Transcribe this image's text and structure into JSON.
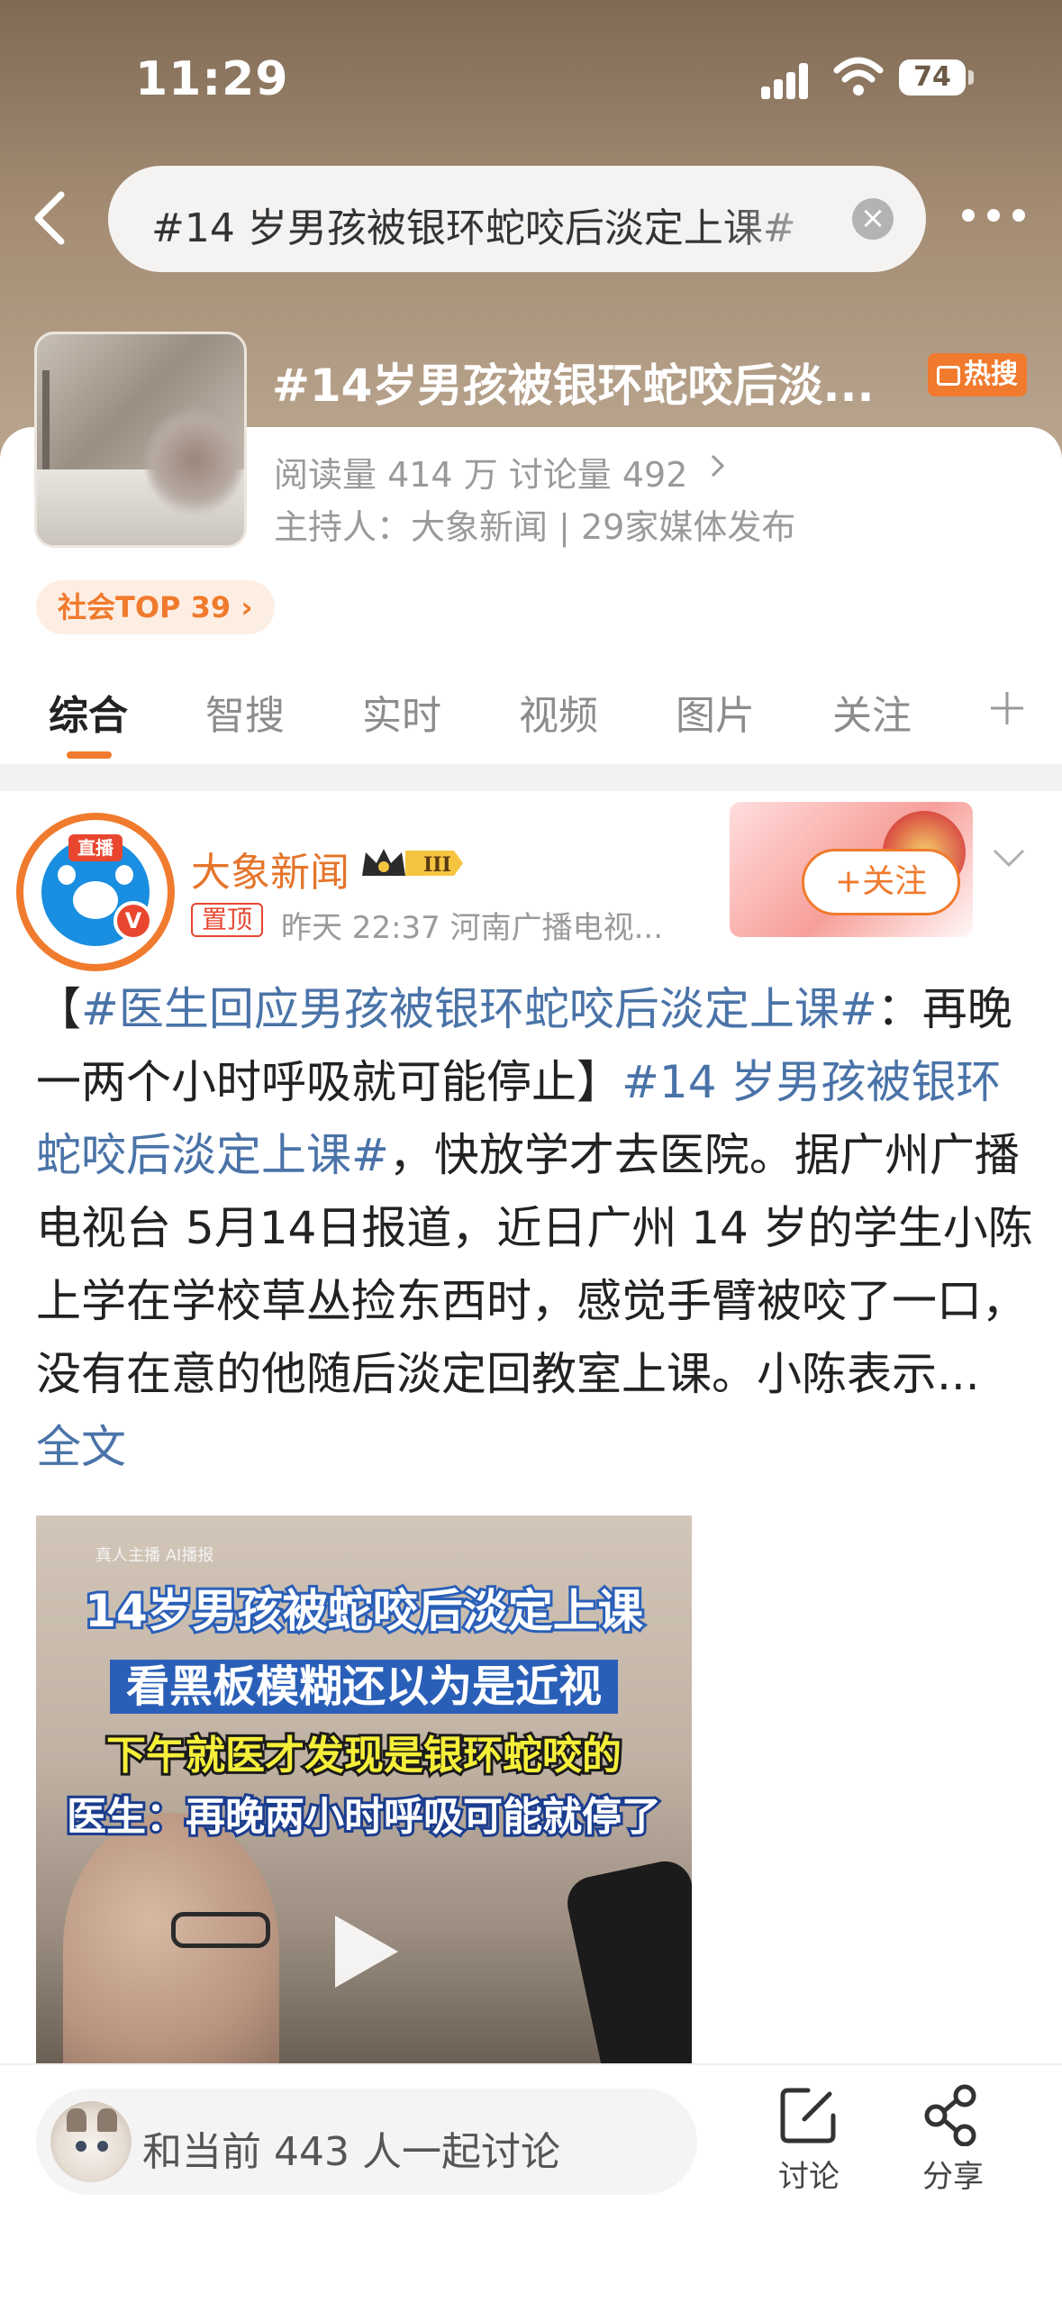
{
  "status_bar": {
    "time": "11:29",
    "battery": "74"
  },
  "search": {
    "query": "#14 岁男孩被银环蛇咬后淡定上课#"
  },
  "topic": {
    "title": "#14岁男孩被银环蛇咬后淡...",
    "hot_badge": "热搜",
    "stats": "阅读量 414 万  讨论量 492",
    "host": "主持人：大象新闻 | 29家媒体发布",
    "rank": "社会TOP 39"
  },
  "tabs": [
    {
      "label": "综合"
    },
    {
      "label": "智搜"
    },
    {
      "label": "实时"
    },
    {
      "label": "视频"
    },
    {
      "label": "图片"
    },
    {
      "label": "关注"
    }
  ],
  "post": {
    "avatar_live": "直播",
    "verified": "V",
    "author": "大象新闻",
    "pinned": "置顶",
    "meta": "昨天 22:37  河南广播电视...",
    "follow": "+关注",
    "text_open": "【",
    "tag1": "#医生回应男孩被银环蛇咬后淡定上课#",
    "text_a": "：再晚一两个小时呼吸就可能停止】",
    "tag2": "#14 岁男孩被银环蛇咬后淡定上课#",
    "text_b": "，快放学才去医院。据广州广播电视台 5月14日报道，近日广州 14 岁的学生小陈上学在学校草丛捡东西时，感觉手臂被咬了一口，没有在意的他随后淡定回教室上课。小陈表示... ",
    "full_link": "全文",
    "video": {
      "ai_label": "真人主播 AI播报",
      "caption1": "14岁男孩被蛇咬后淡定上课",
      "caption2": "看黑板模糊还以为是近视",
      "caption3": "下午就医才发现是银环蛇咬的",
      "caption4": "医生：再晚两小时呼吸可能就停了"
    }
  },
  "bottom": {
    "discuss": "和当前 443 人一起讨论",
    "discuss_label": "讨论",
    "share_label": "分享"
  },
  "colors": {
    "accent": "#f07a2d",
    "link": "#4a73a8",
    "hot": "#f07a2d"
  }
}
